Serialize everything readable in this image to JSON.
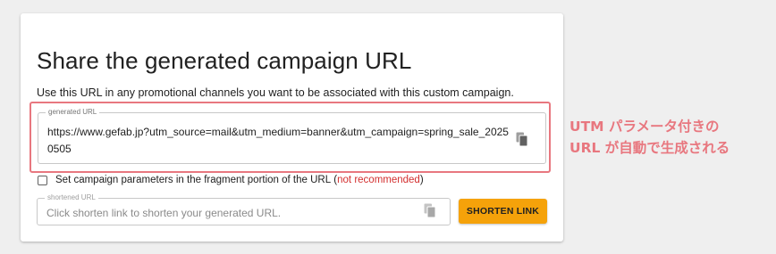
{
  "card": {
    "title": "Share the generated campaign URL",
    "description": "Use this URL in any promotional channels you want to be associated with this custom campaign."
  },
  "generated_url": {
    "label": "generated URL",
    "value": "https://www.gefab.jp?utm_source=mail&utm_medium=banner&utm_campaign=spring_sale_20250505",
    "copy_icon": "copy-icon"
  },
  "fragment_option": {
    "label": "Set campaign parameters in the fragment portion of the URL",
    "open_paren": " (",
    "warning": "not recommended",
    "close_paren": ")",
    "checked": false,
    "warning_color": "#d32f2f"
  },
  "shortened_url": {
    "label": "shortened URL",
    "placeholder": "Click shorten link to shorten your generated URL.",
    "value": "",
    "copy_icon": "copy-icon"
  },
  "shorten_button": {
    "label": "SHORTEN LINK",
    "color": "#f5a20a"
  },
  "annotation": {
    "line1": "UTM パラメータ付きの",
    "line2": "URL が自動で生成される",
    "color": "#e8777f"
  }
}
